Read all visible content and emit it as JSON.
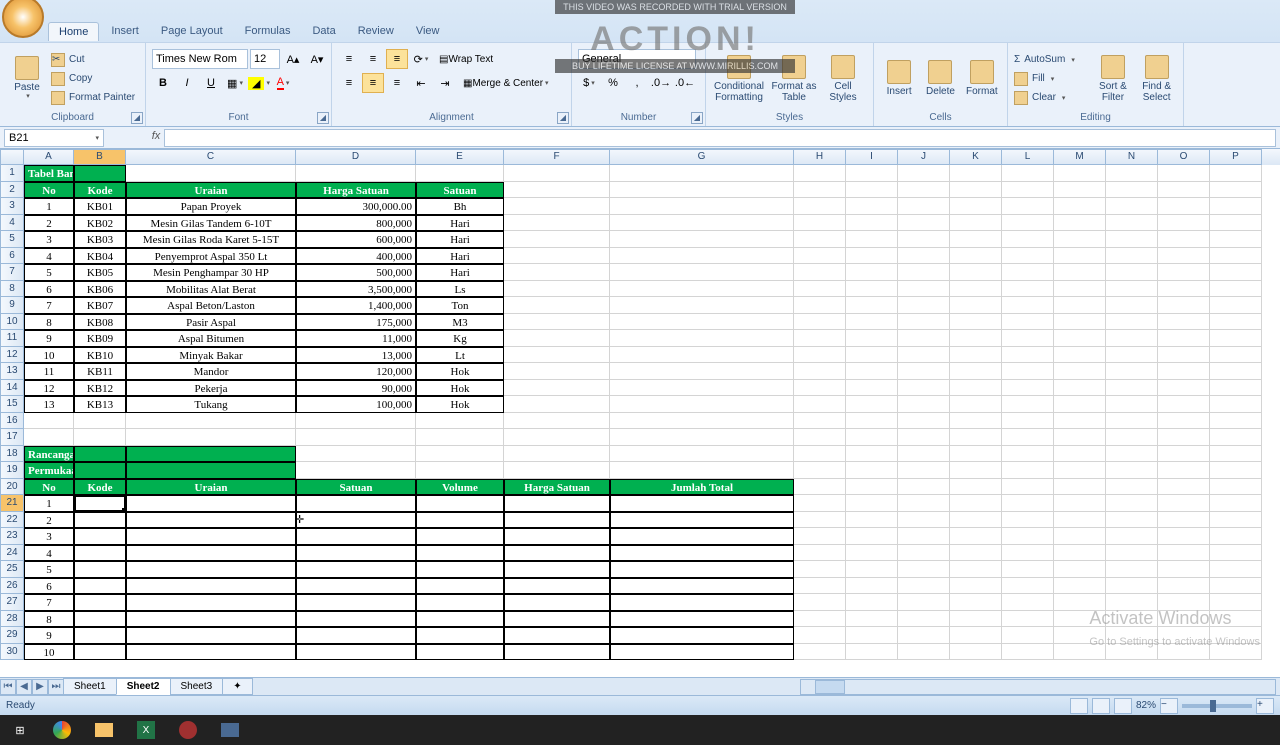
{
  "ribbon": {
    "tabs": [
      "Home",
      "Insert",
      "Page Layout",
      "Formulas",
      "Data",
      "Review",
      "View"
    ],
    "active_tab": "Home",
    "groups": {
      "clipboard": {
        "label": "Clipboard",
        "paste": "Paste",
        "cut": "Cut",
        "copy": "Copy",
        "format_painter": "Format Painter"
      },
      "font": {
        "label": "Font",
        "name": "Times New Rom",
        "size": "12"
      },
      "alignment": {
        "label": "Alignment",
        "wrap": "Wrap Text",
        "merge": "Merge & Center"
      },
      "number": {
        "label": "Number",
        "format": "General"
      },
      "styles": {
        "label": "Styles",
        "cond": "Conditional Formatting",
        "table": "Format as Table",
        "cell": "Cell Styles"
      },
      "cells": {
        "label": "Cells",
        "insert": "Insert",
        "delete": "Delete",
        "format": "Format"
      },
      "editing": {
        "label": "Editing",
        "autosum": "AutoSum",
        "fill": "Fill",
        "clear": "Clear",
        "sort": "Sort & Filter",
        "find": "Find & Select"
      }
    }
  },
  "namebox": "B21",
  "formula": "",
  "columns": [
    "A",
    "B",
    "C",
    "D",
    "E",
    "F",
    "G",
    "H",
    "I",
    "J",
    "K",
    "L",
    "M",
    "N",
    "O",
    "P"
  ],
  "table1": {
    "title": "Tabel Bantu",
    "headers": [
      "No",
      "Kode",
      "Uraian",
      "Harga Satuan",
      "Satuan"
    ],
    "rows": [
      [
        "1",
        "KB01",
        "Papan Proyek",
        "300,000.00",
        "Bh"
      ],
      [
        "2",
        "KB02",
        "Mesin Gilas Tandem 6-10T",
        "800,000",
        "Hari"
      ],
      [
        "3",
        "KB03",
        "Mesin Gilas Roda Karet 5-15T",
        "600,000",
        "Hari"
      ],
      [
        "4",
        "KB04",
        "Penyemprot Aspal 350 Lt",
        "400,000",
        "Hari"
      ],
      [
        "5",
        "KB05",
        "Mesin Penghampar 30 HP",
        "500,000",
        "Hari"
      ],
      [
        "6",
        "KB06",
        "Mobilitas Alat Berat",
        "3,500,000",
        "Ls"
      ],
      [
        "7",
        "KB07",
        "Aspal Beton/Laston",
        "1,400,000",
        "Ton"
      ],
      [
        "8",
        "KB08",
        "Pasir Aspal",
        "175,000",
        "M3"
      ],
      [
        "9",
        "KB09",
        "Aspal Bitumen",
        "11,000",
        "Kg"
      ],
      [
        "10",
        "KB10",
        "Minyak Bakar",
        "13,000",
        "Lt"
      ],
      [
        "11",
        "KB11",
        "Mandor",
        "120,000",
        "Hok"
      ],
      [
        "12",
        "KB12",
        "Pekerja",
        "90,000",
        "Hok"
      ],
      [
        "13",
        "KB13",
        "Tukang",
        "100,000",
        "Hok"
      ]
    ]
  },
  "table2": {
    "title1": "Rancangan Anggaran Biaya Hotmix Lapis",
    "title2": "Permukaan Aspal Beton AC Laston",
    "headers": [
      "No",
      "Kode",
      "Uraian",
      "Satuan",
      "Volume",
      "Harga Satuan",
      "Jumlah Total"
    ],
    "rows": [
      [
        "1"
      ],
      [
        "2"
      ],
      [
        "3"
      ],
      [
        "4"
      ],
      [
        "5"
      ],
      [
        "6"
      ],
      [
        "7"
      ],
      [
        "8"
      ],
      [
        "9"
      ],
      [
        "10"
      ]
    ]
  },
  "sheets": [
    "Sheet1",
    "Sheet2",
    "Sheet3"
  ],
  "active_sheet": "Sheet2",
  "status": "Ready",
  "zoom": "82%",
  "overlay": {
    "top": "THIS VIDEO WAS RECORDED WITH TRIAL VERSION",
    "logo": "ACTION!",
    "bottom": "BUY LIFETIME LICENSE AT WWW.MIRILLIS.COM"
  },
  "watermark": {
    "line1": "Activate Windows",
    "line2": "Go to Settings to activate Windows"
  }
}
